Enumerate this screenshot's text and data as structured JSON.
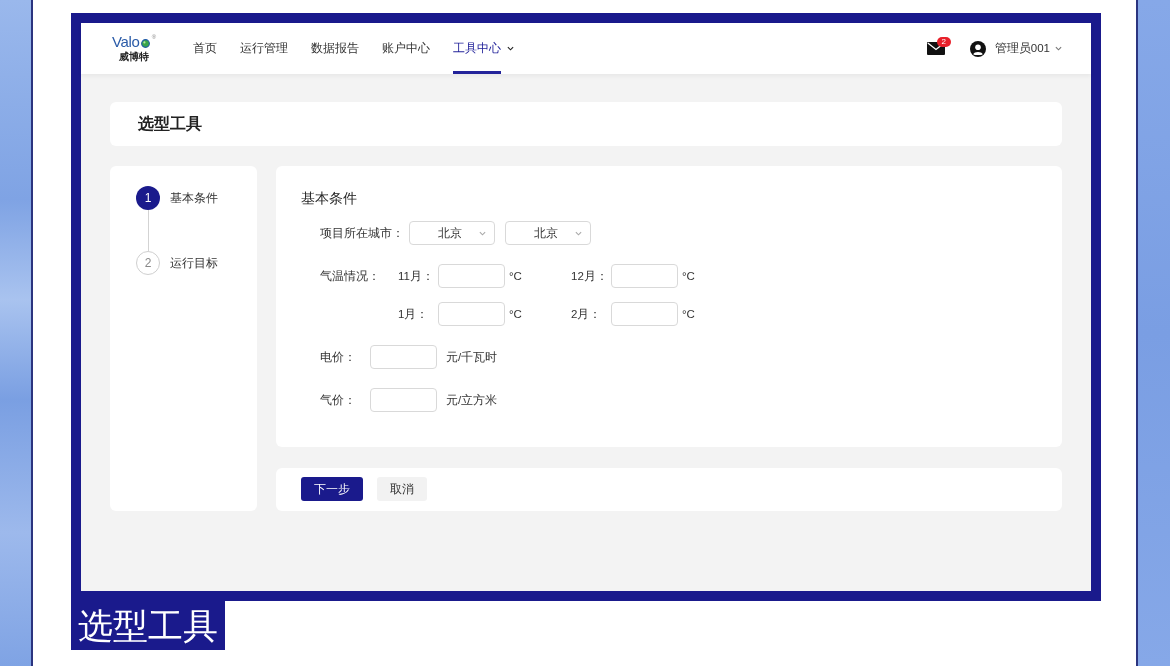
{
  "header": {
    "logo": {
      "wordmark": "Valo",
      "registered": "®",
      "subtitle": "威博特"
    },
    "nav": [
      {
        "label": "首页",
        "selected": false,
        "dropdown": false
      },
      {
        "label": "运行管理",
        "selected": false,
        "dropdown": false
      },
      {
        "label": "数据报告",
        "selected": false,
        "dropdown": false
      },
      {
        "label": "账户中心",
        "selected": false,
        "dropdown": false
      },
      {
        "label": "工具中心",
        "selected": true,
        "dropdown": true
      }
    ],
    "mail": {
      "badge": "2"
    },
    "user": {
      "name": "管理员001"
    }
  },
  "page_title": "选型工具",
  "steps": [
    {
      "number": "1",
      "label": "基本条件",
      "active": true
    },
    {
      "number": "2",
      "label": "运行目标",
      "active": false
    }
  ],
  "form": {
    "heading": "基本条件",
    "rows": [
      {
        "kind": "select",
        "label": "项目所在城市：",
        "selects": [
          {
            "value": "北京"
          },
          {
            "value": "北京"
          }
        ]
      },
      {
        "kind": "temperature",
        "label": "气温情况：",
        "months": [
          {
            "label": "11月：",
            "unit": "°C"
          },
          {
            "label": "12月：",
            "unit": "°C"
          },
          {
            "label": "1月：",
            "unit": "°C"
          },
          {
            "label": "2月：",
            "unit": "°C"
          }
        ]
      },
      {
        "kind": "price",
        "label": "电价：",
        "unit": "元/千瓦时"
      },
      {
        "kind": "price",
        "label": "气价：",
        "unit": "元/立方米"
      }
    ]
  },
  "actions": [
    {
      "label": "下一步",
      "kind": "primary"
    },
    {
      "label": "取消",
      "kind": "secondary"
    }
  ],
  "caption": "选型工具"
}
